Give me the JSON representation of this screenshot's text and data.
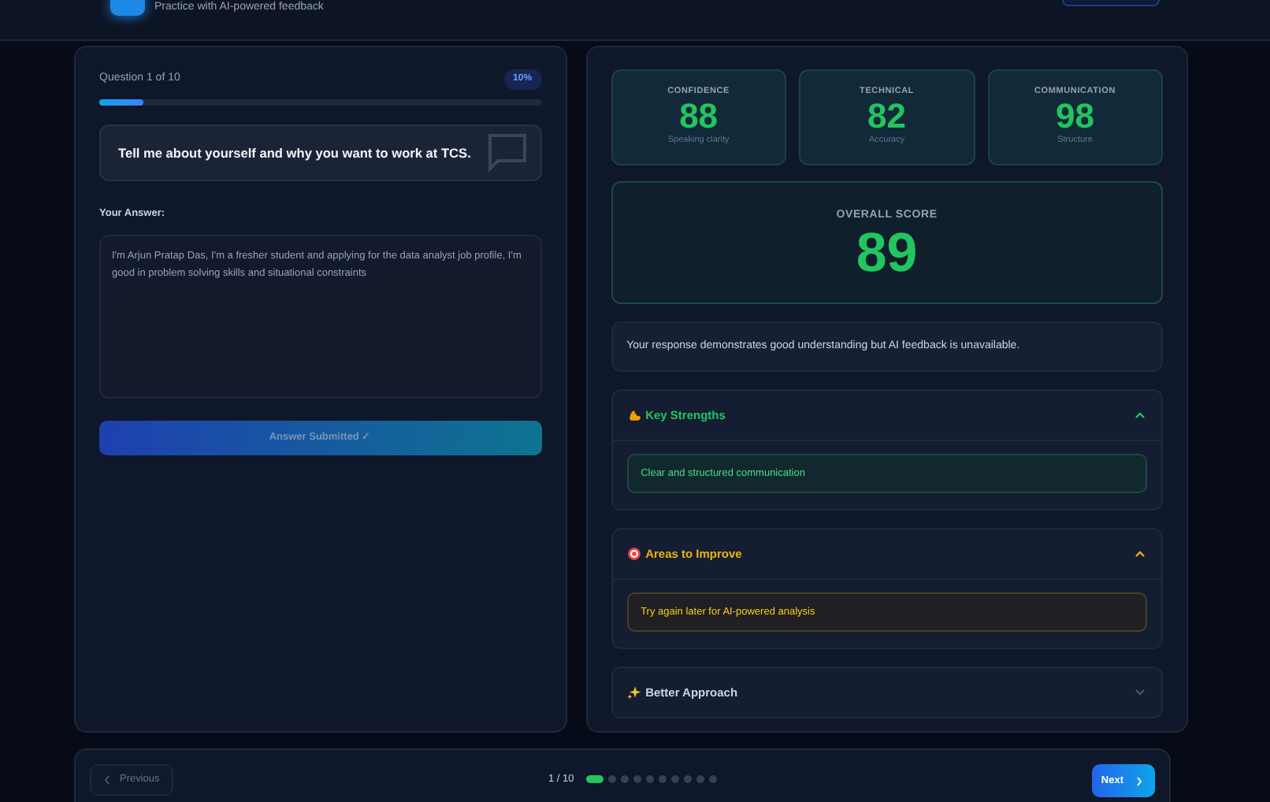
{
  "header": {
    "subtitle": "Practice with AI-powered feedback"
  },
  "question_panel": {
    "counter": "Question 1 of 10",
    "percent_badge": "10%",
    "progress": {
      "level": 0.1
    },
    "question": "Tell me about yourself and why you want to work at TCS.",
    "answer_label": "Your Answer:",
    "answer": "I'm Arjun Pratap Das, I'm a fresher student and applying for the data analyst job profile, I'm good in problem solving skills and situational constraints",
    "submit_button": {
      "label": "Answer Submitted ✓",
      "disabled": true
    }
  },
  "scores": [
    {
      "label": "CONFIDENCE",
      "value": "88",
      "caption": "Speaking clarity"
    },
    {
      "label": "TECHNICAL",
      "value": "82",
      "caption": "Accuracy"
    },
    {
      "label": "COMMUNICATION",
      "value": "98",
      "caption": "Structure"
    }
  ],
  "overall": {
    "label": "OVERALL SCORE",
    "value": "89"
  },
  "summary": "Your response demonstrates good understanding but AI feedback is unavailable.",
  "sections": [
    {
      "kind": "strengths",
      "title": "Key Strengths",
      "expanded": true,
      "items": [
        "Clear and structured communication"
      ]
    },
    {
      "kind": "improve",
      "title": "Areas to Improve",
      "expanded": true,
      "items": [
        "Try again later for AI-powered analysis"
      ]
    },
    {
      "kind": "approach",
      "title": "Better Approach",
      "expanded": false
    }
  ],
  "navigation": {
    "previous": {
      "label": "Previous",
      "disabled": true
    },
    "page": "1 / 10",
    "dots": [
      {
        "selected": true
      },
      {
        "selected": false
      },
      {
        "selected": false
      },
      {
        "selected": false
      },
      {
        "selected": false
      },
      {
        "selected": false
      },
      {
        "selected": false
      },
      {
        "selected": false
      },
      {
        "selected": false
      },
      {
        "selected": false
      }
    ],
    "next": {
      "label": "Next"
    }
  }
}
